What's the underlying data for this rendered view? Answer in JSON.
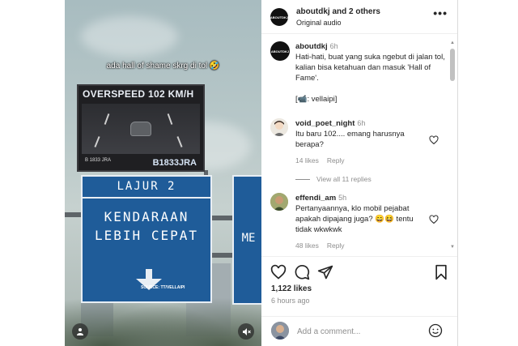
{
  "video": {
    "overlay_caption": "ada hall of shame skrg di tol 🤣",
    "screen_title": "OVERSPEED 102 KM/H",
    "screen_small": "B 1833 JRA",
    "screen_plate": "B1833JRA",
    "sign_line1": "LAJUR 2",
    "sign_line2": "KENDARAAN",
    "sign_line3": "LEBIH CEPAT",
    "sign_source": "SOURCE: TT/VELLAIPI",
    "sign_right_text": "ME"
  },
  "header": {
    "avatar_text": "ABOUTDKJ",
    "username": "aboutdkj",
    "and_others": " and 2 others",
    "subtitle": "Original audio"
  },
  "caption": {
    "username": "aboutdkj",
    "time": "6h",
    "text": "Hati-hati, buat yang suka ngebut di jalan tol, kalian bisa ketahuan dan masuk 'Hall of Fame'.",
    "credit": "[📹: vellaipi]"
  },
  "comments": [
    {
      "username": "void_poet_night",
      "time": "6h",
      "text": "Itu baru 102.... emang harusnya berapa?",
      "likes": "14 likes",
      "reply": "Reply"
    },
    {
      "username": "effendi_am",
      "time": "5h",
      "text": "Pertanyaannya, klo mobil pejabat apakah dipajang juga? 😄😆 tentu tidak wkwkwk",
      "likes": "48 likes",
      "reply": "Reply"
    }
  ],
  "view_replies": "View all 11 replies",
  "post": {
    "likes": "1,122 likes",
    "ago": "6 hours ago"
  },
  "add_comment": {
    "placeholder": "Add a comment..."
  },
  "colors": {
    "sign_blue": "#1f5c99",
    "text": "#262626",
    "muted": "#8e8e8e"
  }
}
